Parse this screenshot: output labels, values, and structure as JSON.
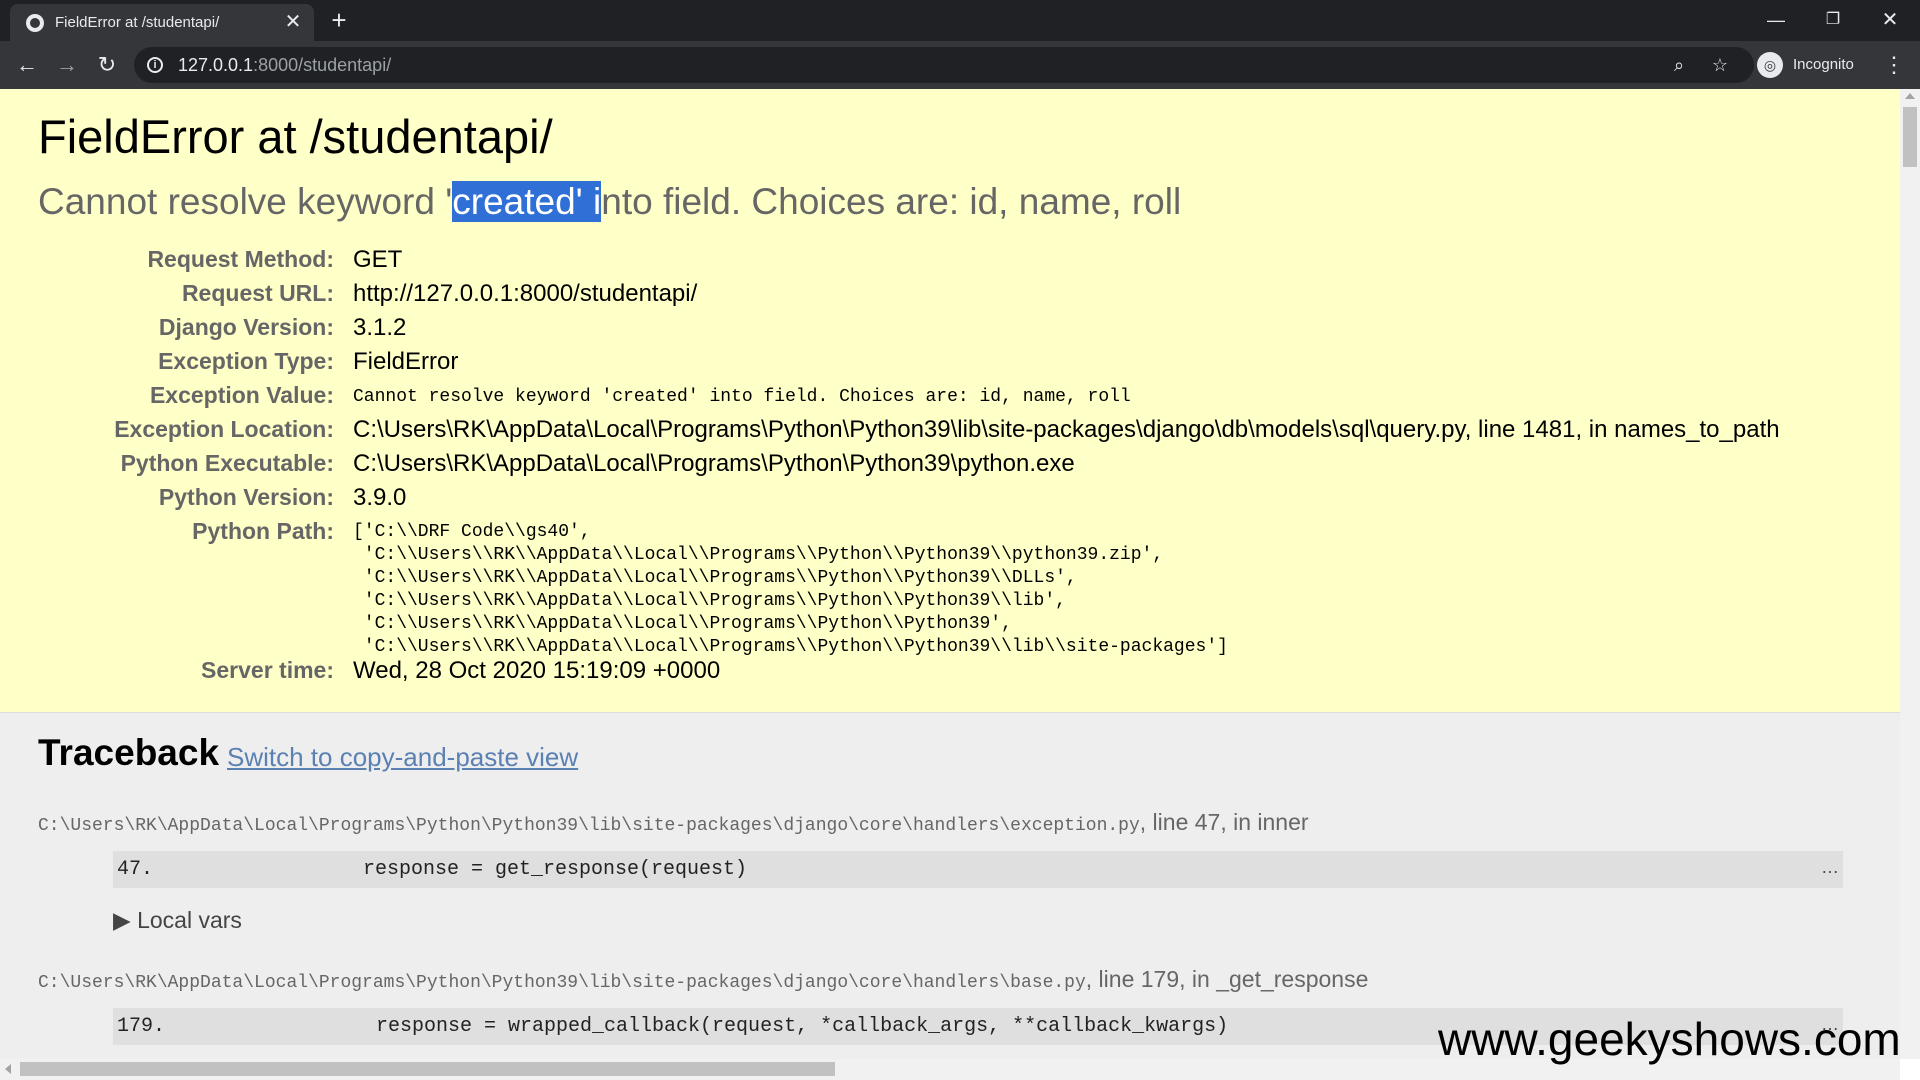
{
  "browser": {
    "tab_title": "FieldError at /studentapi/",
    "tab_close": "✕",
    "new_tab": "+",
    "url_host": "127.0.0.1",
    "url_rest": ":8000/studentapi/",
    "incognito_label": "Incognito",
    "icons": [
      "back-icon",
      "forward-icon",
      "reload-icon",
      "info-icon",
      "zoom-icon",
      "star-icon",
      "incognito-icon",
      "menu-icon",
      "minimize-icon",
      "restore-icon",
      "close-icon"
    ]
  },
  "page": {
    "title": "FieldError at /studentapi/",
    "message_pre": "Cannot resolve keyword '",
    "message_sel": "created' i",
    "message_post": "nto field. Choices are: id, name, roll",
    "meta": [
      {
        "key": "Request Method:",
        "value": "GET"
      },
      {
        "key": "Request URL:",
        "value": "http://127.0.0.1:8000/studentapi/"
      },
      {
        "key": "Django Version:",
        "value": "3.1.2"
      },
      {
        "key": "Exception Type:",
        "value": "FieldError"
      },
      {
        "key": "Exception Value:",
        "value": "Cannot resolve keyword 'created' into field. Choices are: id, name, roll"
      },
      {
        "key": "Exception Location:",
        "value": "C:\\Users\\RK\\AppData\\Local\\Programs\\Python\\Python39\\lib\\site-packages\\django\\db\\models\\sql\\query.py, line 1481, in names_to_path"
      },
      {
        "key": "Python Executable:",
        "value": "C:\\Users\\RK\\AppData\\Local\\Programs\\Python\\Python39\\python.exe"
      },
      {
        "key": "Python Version:",
        "value": "3.9.0"
      },
      {
        "key": "Python Path:",
        "value": "['C:\\\\DRF Code\\\\gs40',\n 'C:\\\\Users\\\\RK\\\\AppData\\\\Local\\\\Programs\\\\Python\\\\Python39\\\\python39.zip',\n 'C:\\\\Users\\\\RK\\\\AppData\\\\Local\\\\Programs\\\\Python\\\\Python39\\\\DLLs',\n 'C:\\\\Users\\\\RK\\\\AppData\\\\Local\\\\Programs\\\\Python\\\\Python39\\\\lib',\n 'C:\\\\Users\\\\RK\\\\AppData\\\\Local\\\\Programs\\\\Python\\\\Python39',\n 'C:\\\\Users\\\\RK\\\\AppData\\\\Local\\\\Programs\\\\Python\\\\Python39\\\\lib\\\\site-packages']"
      },
      {
        "key": "Server time:",
        "value": "Wed, 28 Oct 2020 15:19:09 +0000"
      }
    ],
    "traceback_heading": "Traceback",
    "switch_link": "Switch to copy-and-paste view",
    "frames": [
      {
        "file": "C:\\Users\\RK\\AppData\\Local\\Programs\\Python\\Python39\\lib\\site-packages\\django\\core\\handlers\\exception.py",
        "location": ", line 47, in inner",
        "line_no": "47.",
        "code": "response = get_response(request)",
        "more": "…",
        "local_vars": "▶ Local vars"
      },
      {
        "file": "C:\\Users\\RK\\AppData\\Local\\Programs\\Python\\Python39\\lib\\site-packages\\django\\core\\handlers\\base.py",
        "location": ", line 179, in _get_response",
        "line_no": "179.",
        "code": "response = wrapped_callback(request, *callback_args, **callback_kwargs)",
        "more": "…"
      }
    ]
  },
  "watermark": "www.geekyshows.com",
  "colors": {
    "summary_bg": "#ffffc8",
    "selection": "#2f6fd6",
    "link": "#5b80b2"
  }
}
